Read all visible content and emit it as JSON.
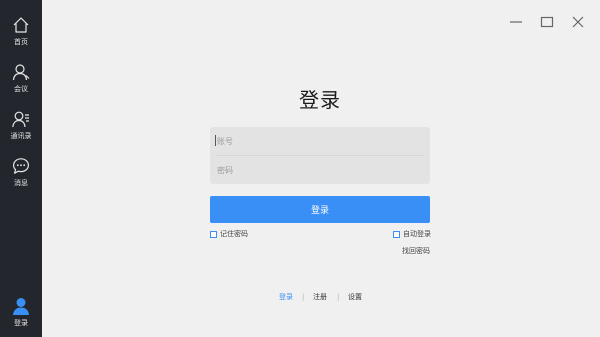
{
  "sidebar": {
    "items": [
      {
        "label": "首页",
        "icon": "home-icon"
      },
      {
        "label": "会议",
        "icon": "user-icon"
      },
      {
        "label": "通讯录",
        "icon": "contacts-icon"
      },
      {
        "label": "消息",
        "icon": "chat-icon"
      }
    ],
    "login": {
      "label": "登录",
      "icon": "avatar-icon"
    }
  },
  "window_controls": [
    "minimize-icon",
    "maximize-icon",
    "close-icon"
  ],
  "login_form": {
    "title": "登录",
    "account": {
      "value": "",
      "placeholder": "账号"
    },
    "password": {
      "value": "",
      "placeholder": "密码"
    },
    "submit_label": "登录",
    "remember_label": "记住密码",
    "remember_checked": false,
    "autologin_label": "自动登录",
    "autologin_checked": false,
    "forgot_label": "找回密码"
  },
  "bottom_links": {
    "login": "登录",
    "separator": "|",
    "register": "注册",
    "settings": "设置"
  },
  "colors": {
    "sidebar_bg": "#23272d",
    "page_bg": "#f0f0f0",
    "accent": "#3a8ff6",
    "field_bg": "#e3e3e3"
  }
}
